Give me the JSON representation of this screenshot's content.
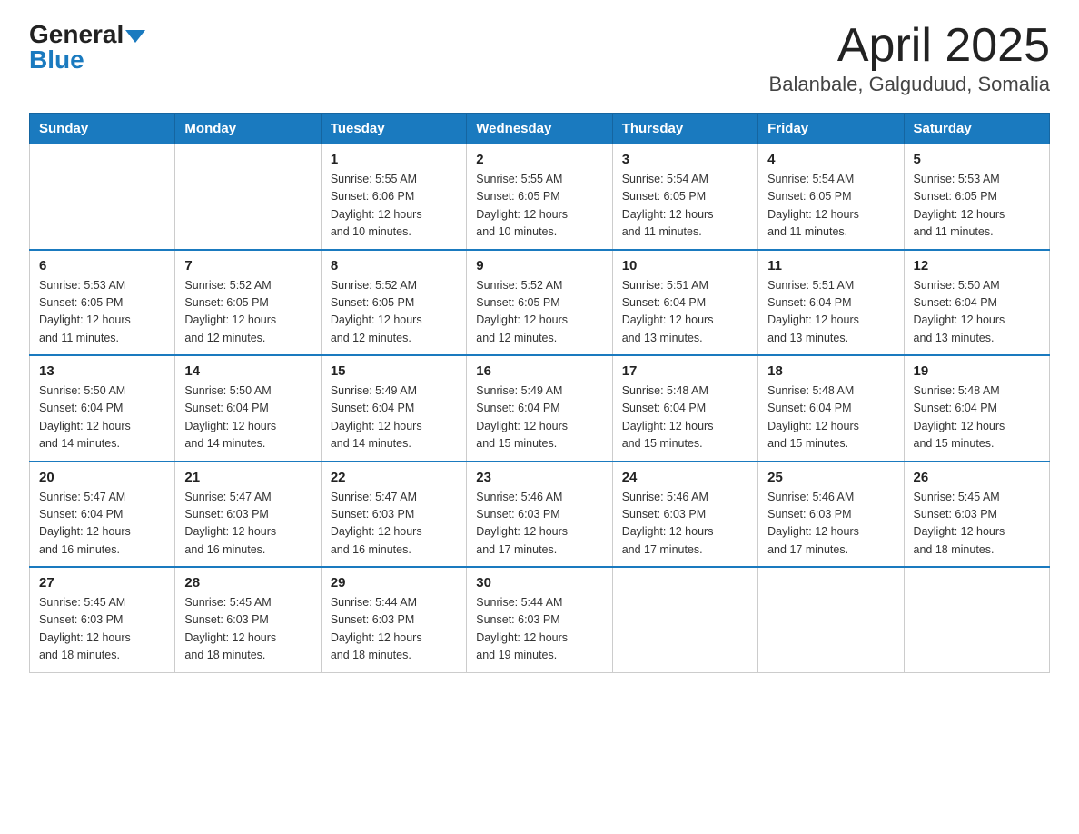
{
  "header": {
    "logo_general": "General",
    "logo_arrow": "▼",
    "logo_blue": "Blue",
    "title": "April 2025",
    "subtitle": "Balanbale, Galguduud, Somalia"
  },
  "weekdays": [
    "Sunday",
    "Monday",
    "Tuesday",
    "Wednesday",
    "Thursday",
    "Friday",
    "Saturday"
  ],
  "weeks": [
    [
      {
        "day": "",
        "info": ""
      },
      {
        "day": "",
        "info": ""
      },
      {
        "day": "1",
        "info": "Sunrise: 5:55 AM\nSunset: 6:06 PM\nDaylight: 12 hours\nand 10 minutes."
      },
      {
        "day": "2",
        "info": "Sunrise: 5:55 AM\nSunset: 6:05 PM\nDaylight: 12 hours\nand 10 minutes."
      },
      {
        "day": "3",
        "info": "Sunrise: 5:54 AM\nSunset: 6:05 PM\nDaylight: 12 hours\nand 11 minutes."
      },
      {
        "day": "4",
        "info": "Sunrise: 5:54 AM\nSunset: 6:05 PM\nDaylight: 12 hours\nand 11 minutes."
      },
      {
        "day": "5",
        "info": "Sunrise: 5:53 AM\nSunset: 6:05 PM\nDaylight: 12 hours\nand 11 minutes."
      }
    ],
    [
      {
        "day": "6",
        "info": "Sunrise: 5:53 AM\nSunset: 6:05 PM\nDaylight: 12 hours\nand 11 minutes."
      },
      {
        "day": "7",
        "info": "Sunrise: 5:52 AM\nSunset: 6:05 PM\nDaylight: 12 hours\nand 12 minutes."
      },
      {
        "day": "8",
        "info": "Sunrise: 5:52 AM\nSunset: 6:05 PM\nDaylight: 12 hours\nand 12 minutes."
      },
      {
        "day": "9",
        "info": "Sunrise: 5:52 AM\nSunset: 6:05 PM\nDaylight: 12 hours\nand 12 minutes."
      },
      {
        "day": "10",
        "info": "Sunrise: 5:51 AM\nSunset: 6:04 PM\nDaylight: 12 hours\nand 13 minutes."
      },
      {
        "day": "11",
        "info": "Sunrise: 5:51 AM\nSunset: 6:04 PM\nDaylight: 12 hours\nand 13 minutes."
      },
      {
        "day": "12",
        "info": "Sunrise: 5:50 AM\nSunset: 6:04 PM\nDaylight: 12 hours\nand 13 minutes."
      }
    ],
    [
      {
        "day": "13",
        "info": "Sunrise: 5:50 AM\nSunset: 6:04 PM\nDaylight: 12 hours\nand 14 minutes."
      },
      {
        "day": "14",
        "info": "Sunrise: 5:50 AM\nSunset: 6:04 PM\nDaylight: 12 hours\nand 14 minutes."
      },
      {
        "day": "15",
        "info": "Sunrise: 5:49 AM\nSunset: 6:04 PM\nDaylight: 12 hours\nand 14 minutes."
      },
      {
        "day": "16",
        "info": "Sunrise: 5:49 AM\nSunset: 6:04 PM\nDaylight: 12 hours\nand 15 minutes."
      },
      {
        "day": "17",
        "info": "Sunrise: 5:48 AM\nSunset: 6:04 PM\nDaylight: 12 hours\nand 15 minutes."
      },
      {
        "day": "18",
        "info": "Sunrise: 5:48 AM\nSunset: 6:04 PM\nDaylight: 12 hours\nand 15 minutes."
      },
      {
        "day": "19",
        "info": "Sunrise: 5:48 AM\nSunset: 6:04 PM\nDaylight: 12 hours\nand 15 minutes."
      }
    ],
    [
      {
        "day": "20",
        "info": "Sunrise: 5:47 AM\nSunset: 6:04 PM\nDaylight: 12 hours\nand 16 minutes."
      },
      {
        "day": "21",
        "info": "Sunrise: 5:47 AM\nSunset: 6:03 PM\nDaylight: 12 hours\nand 16 minutes."
      },
      {
        "day": "22",
        "info": "Sunrise: 5:47 AM\nSunset: 6:03 PM\nDaylight: 12 hours\nand 16 minutes."
      },
      {
        "day": "23",
        "info": "Sunrise: 5:46 AM\nSunset: 6:03 PM\nDaylight: 12 hours\nand 17 minutes."
      },
      {
        "day": "24",
        "info": "Sunrise: 5:46 AM\nSunset: 6:03 PM\nDaylight: 12 hours\nand 17 minutes."
      },
      {
        "day": "25",
        "info": "Sunrise: 5:46 AM\nSunset: 6:03 PM\nDaylight: 12 hours\nand 17 minutes."
      },
      {
        "day": "26",
        "info": "Sunrise: 5:45 AM\nSunset: 6:03 PM\nDaylight: 12 hours\nand 18 minutes."
      }
    ],
    [
      {
        "day": "27",
        "info": "Sunrise: 5:45 AM\nSunset: 6:03 PM\nDaylight: 12 hours\nand 18 minutes."
      },
      {
        "day": "28",
        "info": "Sunrise: 5:45 AM\nSunset: 6:03 PM\nDaylight: 12 hours\nand 18 minutes."
      },
      {
        "day": "29",
        "info": "Sunrise: 5:44 AM\nSunset: 6:03 PM\nDaylight: 12 hours\nand 18 minutes."
      },
      {
        "day": "30",
        "info": "Sunrise: 5:44 AM\nSunset: 6:03 PM\nDaylight: 12 hours\nand 19 minutes."
      },
      {
        "day": "",
        "info": ""
      },
      {
        "day": "",
        "info": ""
      },
      {
        "day": "",
        "info": ""
      }
    ]
  ]
}
